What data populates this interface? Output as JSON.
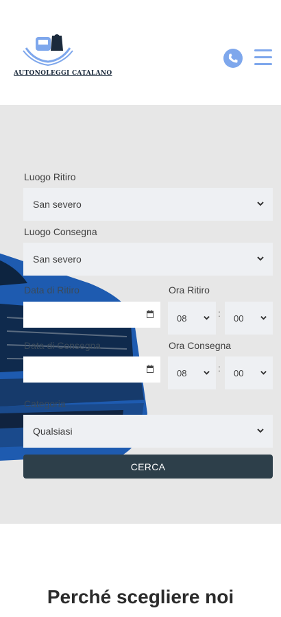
{
  "header": {
    "logo_text": "AUTONOLEGGI CATALANO",
    "phone_icon": "phone-icon",
    "menu_icon": "hamburger-menu-icon"
  },
  "form": {
    "pickup_location_label": "Luogo Ritiro",
    "pickup_location_value": "San severo",
    "dropoff_location_label": "Luogo Consegna",
    "dropoff_location_value": "San severo",
    "pickup_date_label": "Data di Ritiro",
    "pickup_time_label": "Ora Ritiro",
    "pickup_hour": "08",
    "pickup_minute": "00",
    "dropoff_date_label": "Data di Consegna",
    "dropoff_time_label": "Ora Consegna",
    "dropoff_hour": "08",
    "dropoff_minute": "00",
    "category_label": "Categoria",
    "category_value": "Qualsiasi",
    "search_label": "CERCA"
  },
  "colors": {
    "accent": "#7ea7ec",
    "button": "#2d3f4a",
    "hero_bg": "#e7e7e7"
  },
  "section": {
    "title": "Perché scegliere noi"
  }
}
